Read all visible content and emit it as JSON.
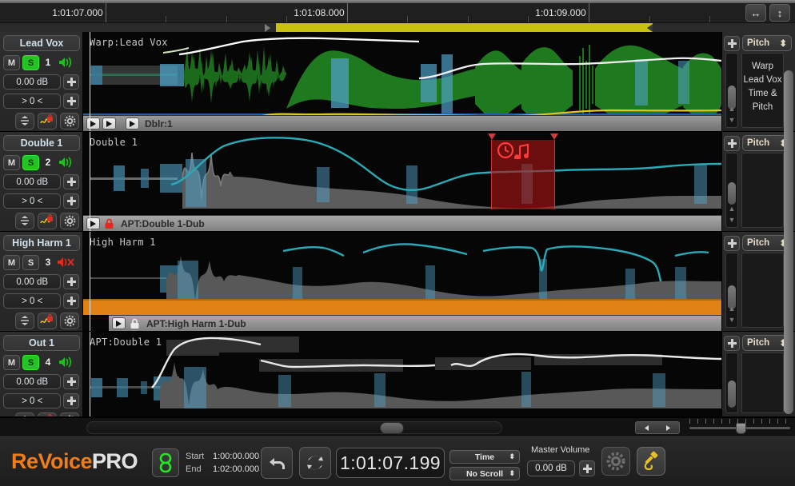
{
  "ruler": {
    "labels": [
      "1:01:07.000",
      "1:01:08.000",
      "1:01:09.000"
    ],
    "zoom_h_icon": "horizontal-resize-icon",
    "zoom_v_icon": "vertical-resize-icon",
    "selection_color": "#c8c20f"
  },
  "tracks": [
    {
      "name": "Lead Vox",
      "mute_label": "M",
      "solo_label": "S",
      "solo_on": true,
      "number": "1",
      "speaker_state": "on",
      "gain": "0.00 dB",
      "pan": "> 0 <",
      "clip_label": "Warp:Lead Vox",
      "strip_label": "Dblr:1",
      "strip_locked": false,
      "pitch_label": "Pitch",
      "panel_text": "Warp\nLead Vox\nTime &\nPitch"
    },
    {
      "name": "Double 1",
      "mute_label": "M",
      "solo_label": "S",
      "solo_on": true,
      "number": "2",
      "speaker_state": "on",
      "gain": "0.00 dB",
      "pan": "> 0 <",
      "clip_label": "Double 1",
      "strip_label": "APT:Double 1-Dub",
      "strip_locked": true,
      "lock_color": "#e02b20",
      "pitch_label": "Pitch",
      "panel_text": ""
    },
    {
      "name": "High Harm 1",
      "mute_label": "M",
      "solo_label": "S",
      "solo_on": false,
      "number": "3",
      "speaker_state": "muted",
      "gain": "0.00 dB",
      "pan": "> 0 <",
      "clip_label": "High Harm 1",
      "strip_label": "APT:High Harm 1-Dub",
      "strip_locked": true,
      "lock_color": "#e8e8e8",
      "pitch_label": "Pitch",
      "panel_text": ""
    },
    {
      "name": "Out 1",
      "mute_label": "M",
      "solo_label": "S",
      "solo_on": true,
      "number": "4",
      "speaker_state": "on",
      "gain": "0.00 dB",
      "pan": "> 0 <",
      "clip_label": "APT:Double 1",
      "strip_label": "",
      "strip_locked": false,
      "pitch_label": "Pitch",
      "panel_text": ""
    }
  ],
  "toolbar": {
    "logo_re": "ReVoice",
    "logo_pro": "PRO",
    "link_icon": "chain-link-icon",
    "start_label": "Start",
    "start_value": "1:00:00.000",
    "end_label": "End",
    "end_value": "1:02:00.000",
    "undo_icon": "undo-arrow-icon",
    "redo_icon": "loop-arrows-icon",
    "timecode": "1:01:07.199",
    "time_mode": "Time",
    "scroll_mode": "No Scroll",
    "master_volume_label": "Master Volume",
    "master_volume_value": "0.00 dB",
    "settings_icon": "gear-icon",
    "audio_cable_icon": "audio-cable-icon"
  },
  "colors": {
    "accent_orange": "#f07d18",
    "solo_green": "#22c322",
    "selection_yellow": "#c8c20f",
    "red_region": "#aa1414",
    "floor_orange": "#e08214",
    "floor_blue": "#1b63a8"
  }
}
